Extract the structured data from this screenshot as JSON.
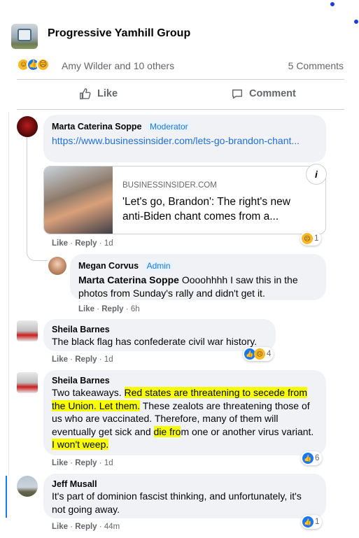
{
  "group": {
    "name": "Progressive Yamhill Group"
  },
  "reactions": {
    "summary": "Amy Wilder and 10 others",
    "comments": "5 Comments",
    "icons": [
      "wow-emoji",
      "like-emoji",
      "sad-emoji"
    ]
  },
  "actions": {
    "like": "Like",
    "comment": "Comment"
  },
  "comments": [
    {
      "author": "Marta Caterina Soppe",
      "badge": "Moderator",
      "link_text": "https://www.businessinsider.com/lets-go-brandon-chant...",
      "card": {
        "domain": "BUSINESSINSIDER.COM",
        "title": "'Let's go, Brandon': The right's new anti-Biden chant comes from a..."
      },
      "meta": {
        "like": "Like",
        "reply": "Reply",
        "time": "1d"
      },
      "reaction_count": "1"
    },
    {
      "author": "Megan Corvus",
      "badge": "Admin",
      "mention": "Marta Caterina Soppe",
      "text": "Oooohhhh I saw this in the photos from Sunday's rally and didn't get it.",
      "meta": {
        "like": "Like",
        "reply": "Reply",
        "time": "6h"
      }
    },
    {
      "author": "Sheila Barnes",
      "text": "The black flag has confederate civil war history.",
      "meta": {
        "like": "Like",
        "reply": "Reply",
        "time": "1d"
      },
      "reaction_count": "4"
    },
    {
      "author": "Sheila Barnes",
      "parts": {
        "p1": "Two takeaways. ",
        "h1": "Red states are threatening to secede from the Union. Let them.",
        "p2": " These zealots are threatening those of us who are vaccinated. Therefore, many of them will eventually get sick and ",
        "h2": "die fro",
        "p3": "m one or another virus variant. ",
        "h3": "I won't weep."
      },
      "meta": {
        "like": "Like",
        "reply": "Reply",
        "time": "1d"
      },
      "reaction_count": "6"
    },
    {
      "author": "Jeff Musall",
      "text": "It's part of dominion fascist thinking, and unfortunately, it's not going away.",
      "meta": {
        "like": "Like",
        "reply": "Reply",
        "time": "44m"
      },
      "reaction_count": "1"
    }
  ],
  "colors": {
    "highlight": "#f8ff00",
    "link": "#216fdb",
    "accent": "#1877f2"
  }
}
